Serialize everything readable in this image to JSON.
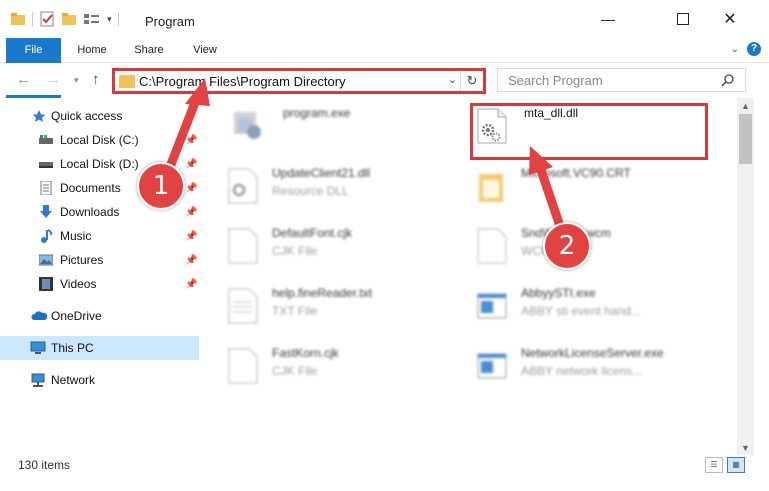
{
  "window": {
    "title": "Program"
  },
  "ribbon": {
    "tabs": [
      "File",
      "Home",
      "Share",
      "View"
    ]
  },
  "address": {
    "path": "C:\\Program Files\\Program Directory"
  },
  "search": {
    "placeholder": "Search Program"
  },
  "sidebar": {
    "items": [
      {
        "label": "Quick access",
        "icon": "star-icon"
      },
      {
        "label": "Local Disk (C:)",
        "icon": "drive-icon"
      },
      {
        "label": "Local Disk (D:)",
        "icon": "drive-icon"
      },
      {
        "label": "Documents",
        "icon": "documents-icon"
      },
      {
        "label": "Downloads",
        "icon": "download-arrow-icon"
      },
      {
        "label": "Music",
        "icon": "music-note-icon"
      },
      {
        "label": "Pictures",
        "icon": "pictures-icon"
      },
      {
        "label": "Videos",
        "icon": "film-icon"
      },
      {
        "label": "OneDrive",
        "icon": "cloud-icon"
      },
      {
        "label": "This PC",
        "icon": "computer-icon"
      },
      {
        "label": "Network",
        "icon": "network-icon"
      }
    ]
  },
  "files": [
    {
      "name": "program.exe",
      "type": ""
    },
    {
      "name": "mta_dll.dll",
      "type": ""
    },
    {
      "name": "UpdateClient21.dll",
      "type": "Resource DLL"
    },
    {
      "name": "Microsoft.VC90.CRT",
      "type": ""
    },
    {
      "name": "DefaultFont.cjk",
      "type": "CJK File"
    },
    {
      "name": "SndWWW2.wcm",
      "type": "WCM File"
    },
    {
      "name": "help.fineReader.txt",
      "type": "TXT File"
    },
    {
      "name": "AbbyySTI.exe",
      "type": "ABBY sti event hand..."
    },
    {
      "name": "FastKorn.cjk",
      "type": "CJK File"
    },
    {
      "name": "NetworkLicenseServer.exe",
      "type": "ABBY network licens..."
    }
  ],
  "status": {
    "items_count": "130 items"
  },
  "callouts": [
    "1",
    "2"
  ],
  "colors": {
    "accent": "#1979ca",
    "highlight": "#d9383a",
    "selected": "#cce8ff"
  }
}
